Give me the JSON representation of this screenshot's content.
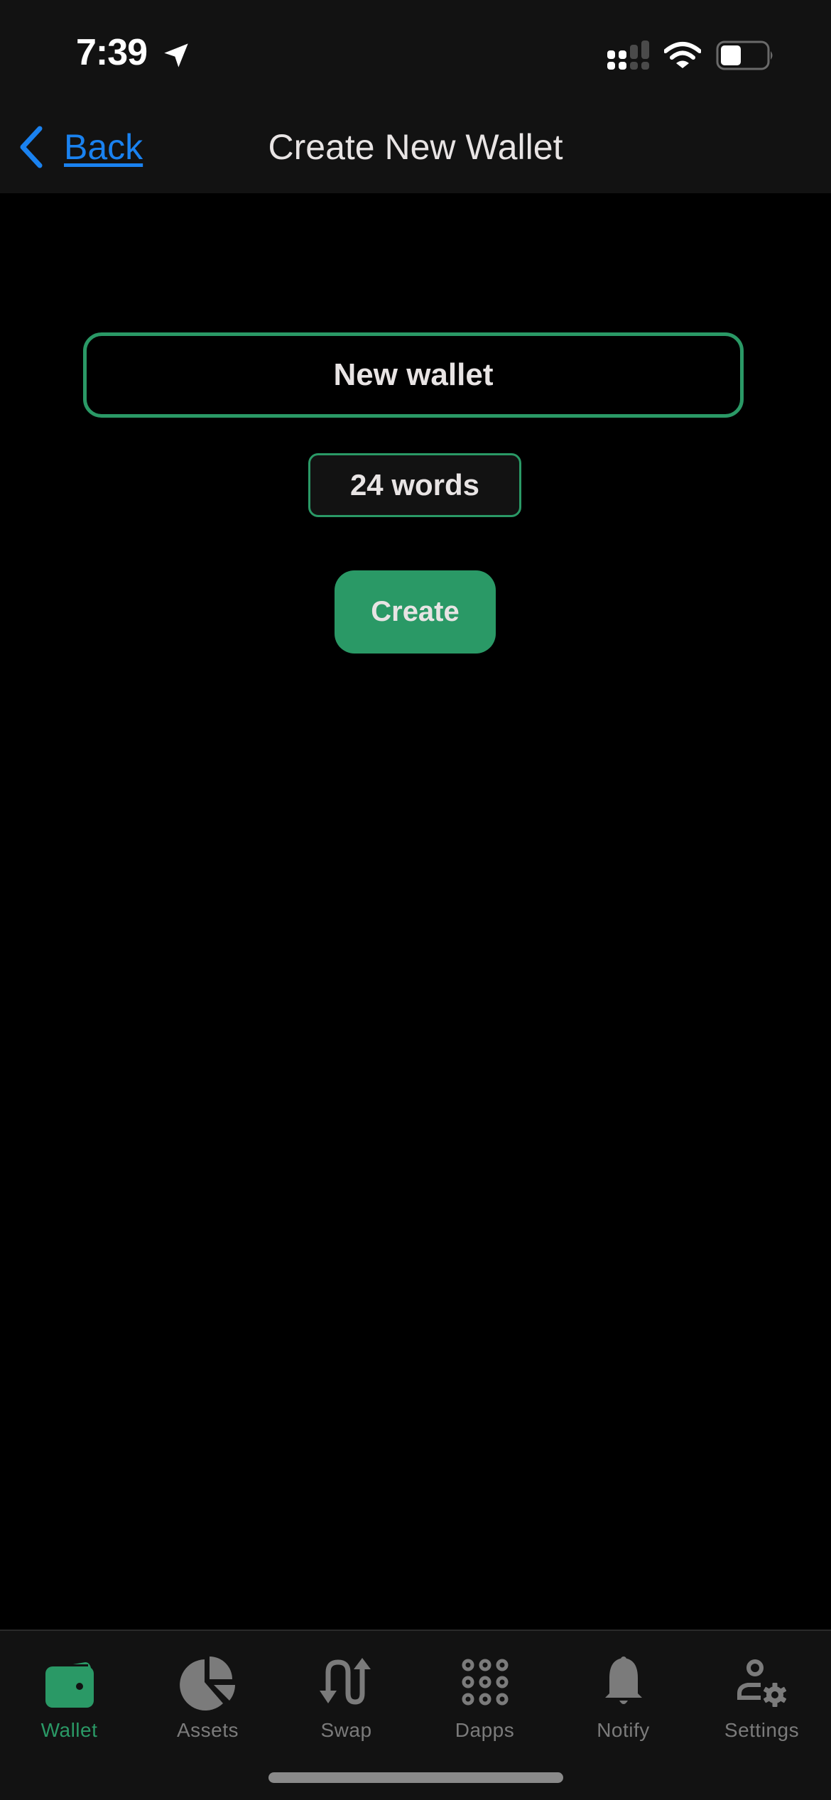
{
  "status_bar": {
    "time": "7:39",
    "icons": [
      "location-arrow-icon",
      "cellular-signal-icon",
      "wifi-icon",
      "battery-icon"
    ]
  },
  "nav": {
    "back_label": "Back",
    "title": "Create New Wallet"
  },
  "form": {
    "wallet_name_value": "New wallet",
    "word_count_selected": "24 words",
    "create_label": "Create"
  },
  "tabs": [
    {
      "label": "Wallet",
      "icon": "wallet-icon",
      "active": true
    },
    {
      "label": "Assets",
      "icon": "pie-chart-icon",
      "active": false
    },
    {
      "label": "Swap",
      "icon": "swap-arrows-icon",
      "active": false
    },
    {
      "label": "Dapps",
      "icon": "grid-dots-icon",
      "active": false
    },
    {
      "label": "Notify",
      "icon": "bell-icon",
      "active": false
    },
    {
      "label": "Settings",
      "icon": "user-gear-icon",
      "active": false
    }
  ],
  "colors": {
    "accent": "#2a9966",
    "link": "#1a82f0",
    "inactive": "#7b7b7b",
    "bar_bg": "#121212"
  }
}
